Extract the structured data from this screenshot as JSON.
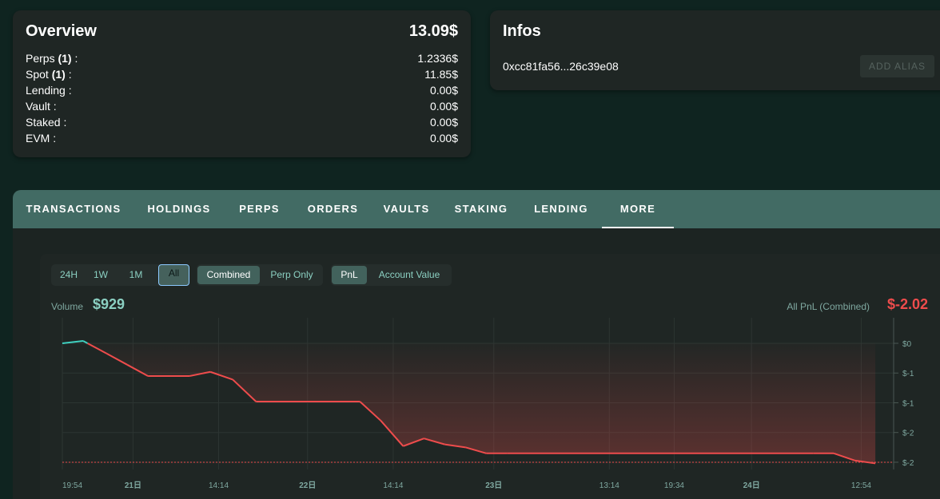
{
  "overview": {
    "title": "Overview",
    "total": "13.09$",
    "rows": [
      {
        "label": "Perps",
        "count": "(1)",
        "colon": " :",
        "value": "1.2336$"
      },
      {
        "label": "Spot",
        "count": "(1)",
        "colon": " :",
        "value": "11.85$"
      },
      {
        "label": "Lending :",
        "value": "0.00$"
      },
      {
        "label": "Vault :",
        "value": "0.00$"
      },
      {
        "label": "Staked :",
        "value": "0.00$"
      },
      {
        "label": "EVM :",
        "value": "0.00$"
      }
    ]
  },
  "infos": {
    "title": "Infos",
    "address": "0xcc81fa56...26c39e08",
    "add_alias_label": "ADD ALIAS"
  },
  "tabs": [
    {
      "label": "TRANSACTIONS"
    },
    {
      "label": "HOLDINGS"
    },
    {
      "label": "PERPS"
    },
    {
      "label": "ORDERS"
    },
    {
      "label": "VAULTS"
    },
    {
      "label": "STAKING"
    },
    {
      "label": "LENDING"
    },
    {
      "label": "MORE",
      "active": true
    }
  ],
  "filters": {
    "range": [
      "24H",
      "1W",
      "1M",
      "All"
    ],
    "range_selected": "All",
    "scope": [
      "Combined",
      "Perp Only"
    ],
    "scope_selected": "Combined",
    "metric": [
      "PnL",
      "Account Value"
    ],
    "metric_selected": "PnL"
  },
  "stats": {
    "volume_label": "Volume",
    "volume_value": "$929",
    "pnl_label": "All PnL (Combined)",
    "pnl_value": "$-2.02"
  },
  "colors": {
    "positive": "#3fd1c0",
    "negative": "#ee4c4c",
    "accent": "#8bd0c2"
  },
  "chart_data": {
    "type": "area",
    "y_tick_labels": [
      "$0",
      "$-1",
      "$-1",
      "$-2",
      "$-2"
    ],
    "y_ticks": [
      0,
      -0.5,
      -1.0,
      -1.5,
      -2.0
    ],
    "ylim": [
      -2.05,
      0.1
    ],
    "x_tick_labels": [
      {
        "label": "19:54",
        "pos": 0.0,
        "bold": false
      },
      {
        "label": "21日",
        "pos": 0.085,
        "bold": true
      },
      {
        "label": "14:14",
        "pos": 0.188,
        "bold": false
      },
      {
        "label": "22日",
        "pos": 0.295,
        "bold": true
      },
      {
        "label": "14:14",
        "pos": 0.398,
        "bold": false
      },
      {
        "label": "23日",
        "pos": 0.519,
        "bold": true
      },
      {
        "label": "13:14",
        "pos": 0.658,
        "bold": false
      },
      {
        "label": "19:34",
        "pos": 0.736,
        "bold": false
      },
      {
        "label": "24日",
        "pos": 0.829,
        "bold": true
      },
      {
        "label": "12:54",
        "pos": 0.961,
        "bold": false
      }
    ],
    "reference_line": -2.0,
    "series": [
      {
        "x": [
          0.0,
          0.025,
          0.053,
          0.078,
          0.103,
          0.153,
          0.178,
          0.205,
          0.233,
          0.358,
          0.383,
          0.41,
          0.435,
          0.46,
          0.485,
          0.51,
          0.535,
          0.903,
          0.928,
          0.953,
          0.978
        ],
        "values": [
          0.0,
          0.04,
          -0.17,
          -0.36,
          -0.55,
          -0.55,
          -0.48,
          -0.61,
          -0.98,
          -0.98,
          -1.3,
          -1.73,
          -1.6,
          -1.7,
          -1.75,
          -1.85,
          -1.85,
          -1.85,
          -1.85,
          -1.97,
          -2.02
        ]
      }
    ]
  }
}
